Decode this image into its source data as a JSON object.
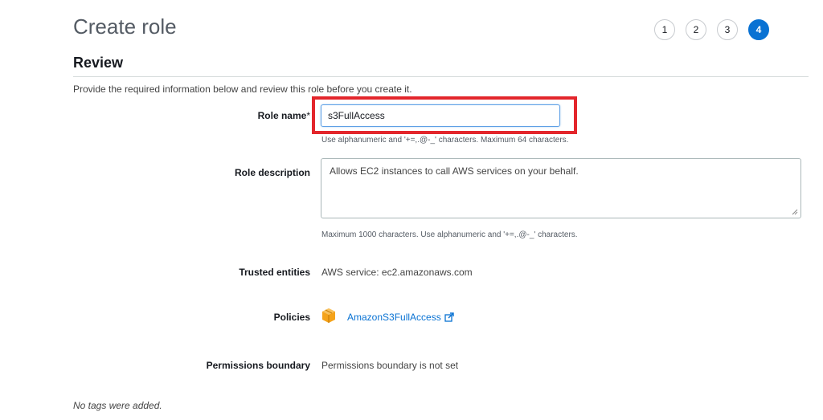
{
  "header": {
    "title": "Create role",
    "steps": [
      "1",
      "2",
      "3",
      "4"
    ],
    "active_step": "4"
  },
  "section": {
    "title": "Review",
    "intro": "Provide the required information below and review this role before you create it."
  },
  "role_name": {
    "label": "Role name",
    "required_mark": "*",
    "value": "s3FullAccess",
    "hint": "Use alphanumeric and '+=,.@-_' characters. Maximum 64 characters."
  },
  "role_description": {
    "label": "Role description",
    "value": "Allows EC2 instances to call AWS services on your behalf.",
    "hint": "Maximum 1000 characters. Use alphanumeric and '+=,.@-_' characters."
  },
  "trusted_entities": {
    "label": "Trusted entities",
    "value": "AWS service: ec2.amazonaws.com"
  },
  "policies": {
    "label": "Policies",
    "icon": "policy-package-icon",
    "link_text": "AmazonS3FullAccess",
    "link_icon": "external-link-icon"
  },
  "permissions_boundary": {
    "label": "Permissions boundary",
    "value": "Permissions boundary is not set"
  },
  "tags": {
    "note": "No tags were added."
  },
  "colors": {
    "accent": "#0972d3",
    "highlight": "#e3262c",
    "policy_icon": "#f5a31a"
  }
}
